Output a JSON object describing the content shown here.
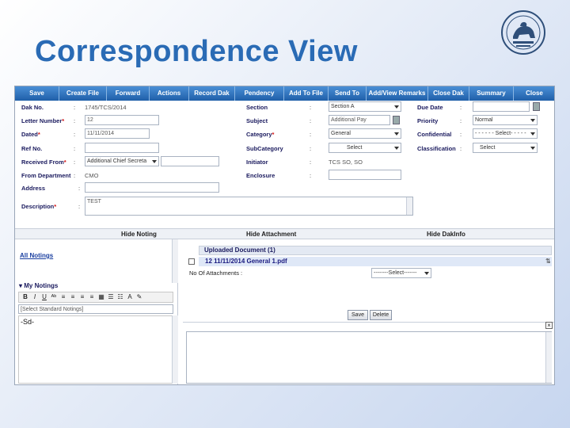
{
  "slide": {
    "title": "Correspondence View"
  },
  "colors": {
    "title": "#2a6bb5",
    "toolbar": "#1f5fa8",
    "required_mark": "#d01010",
    "link": "#1a3fa0"
  },
  "toolbar": {
    "buttons": [
      "Save",
      "Create File",
      "Forward",
      "Actions",
      "Record Dak",
      "Pendency",
      "Add To File",
      "Send To",
      "Add/View Remarks",
      "Close Dak",
      "Summary",
      "Close"
    ]
  },
  "form": {
    "dak_no": {
      "label": "Dak No.",
      "value": "1745/TCS/2014"
    },
    "letter_number": {
      "label": "Letter Number",
      "required": "*",
      "value": "12"
    },
    "dated": {
      "label": "Dated",
      "required": "*",
      "value": "11/11/2014"
    },
    "ref_no": {
      "label": "Ref No.",
      "value": ""
    },
    "received_from": {
      "label": "Received From",
      "required": "*",
      "value": "Additional Chief Secreta"
    },
    "from_department": {
      "label": "From Department",
      "value": "CMO"
    },
    "address": {
      "label": "Address",
      "value": ""
    },
    "description": {
      "label": "Description",
      "required": "*",
      "value": "TEST"
    },
    "section": {
      "label": "Section",
      "value": "Section A"
    },
    "subject": {
      "label": "Subject",
      "value": "Additional Pay"
    },
    "category": {
      "label": "Category",
      "required": "*",
      "value": "General"
    },
    "subcategory": {
      "label": "SubCategory",
      "value": "Select"
    },
    "initiator": {
      "label": "Initiator",
      "value": "TCS SO, SO"
    },
    "enclosure": {
      "label": "Enclosure",
      "value": ""
    },
    "due_date": {
      "label": "Due Date",
      "value": ""
    },
    "priority": {
      "label": "Priority",
      "value": "Normal"
    },
    "confidential": {
      "label": "Confidential",
      "value": "- - - - - - Select- - - - -"
    },
    "classification": {
      "label": "Classification",
      "value": "Select"
    },
    "colon": ":"
  },
  "sections": {
    "hide_noting": "Hide Noting",
    "hide_attachment": "Hide Attachment",
    "hide_dakinfo": "Hide DakInfo"
  },
  "notings": {
    "all_notings": "All Notings",
    "my_notings": "My Notings",
    "standard_select": "[Select Standard Notings]",
    "content": "-Sd-",
    "rte_buttons": [
      "B",
      "I",
      "U"
    ]
  },
  "attachments": {
    "header": "Uploaded Document (1)",
    "document": "12  11/11/2014  General  1.pdf",
    "count_label": "No Of Attachments :",
    "select_value": "--------Select-------",
    "save": "Save",
    "delete": "Delete"
  }
}
